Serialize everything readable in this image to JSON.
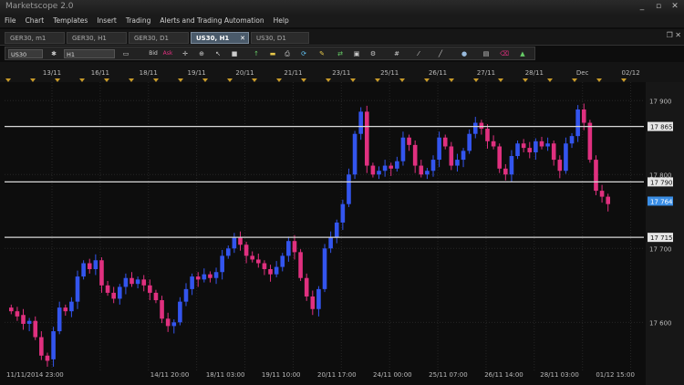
{
  "app": {
    "title": "Marketscope 2.0",
    "minimize": "_",
    "restore": "▫",
    "close": "✕"
  },
  "menu": [
    "File",
    "Chart",
    "Templates",
    "Insert",
    "Trading",
    "Alerts and Trading Automation",
    "Help"
  ],
  "tabs": [
    {
      "label": "GER30, m1",
      "active": false
    },
    {
      "label": "GER30, H1",
      "active": false
    },
    {
      "label": "GER30, D1",
      "active": false
    },
    {
      "label": "US30, H1",
      "active": true
    },
    {
      "label": "US30, D1",
      "active": false
    }
  ],
  "toolbar": {
    "instrument": "US30",
    "timeframe": "H1",
    "bid_label": "Bid",
    "ask_label": "Ask"
  },
  "colors": {
    "bull": "#3355ee",
    "bear": "#e0307f",
    "hline": "#d8d8d8",
    "price_tag": "#3a8ee6",
    "marker": "#c89b2a"
  },
  "chart_data": {
    "type": "candlestick",
    "y_ticks": [
      17600,
      17700,
      17800,
      17900
    ],
    "y_tick_labels": [
      "17 600",
      "17 700",
      "17 800",
      "17 900"
    ],
    "ylim": [
      17535,
      17925
    ],
    "top_date_labels": [
      "13/11",
      "16/11",
      "18/11",
      "19/11",
      "20/11",
      "21/11",
      "23/11",
      "25/11",
      "26/11",
      "27/11",
      "28/11",
      "Dec",
      "02/12"
    ],
    "bottom_time_labels": [
      "11/11/2014 23:00",
      "14/11 20:00",
      "18/11 03:00",
      "19/11 10:00",
      "20/11 17:00",
      "24/11 00:00",
      "25/11 07:00",
      "26/11 14:00",
      "28/11 03:00",
      "01/12 15:00"
    ],
    "horizontal_lines": [
      {
        "value": 17865,
        "label": "17 865"
      },
      {
        "value": 17790,
        "label": "17 790"
      },
      {
        "value": 17715,
        "label": "17 715"
      }
    ],
    "current_price": {
      "value": 17764,
      "label": "17 764"
    },
    "candles": [
      [
        17620,
        17615
      ],
      [
        17615,
        17608
      ],
      [
        17610,
        17598
      ],
      [
        17598,
        17602
      ],
      [
        17602,
        17580
      ],
      [
        17580,
        17555
      ],
      [
        17555,
        17548
      ],
      [
        17550,
        17588
      ],
      [
        17588,
        17620
      ],
      [
        17620,
        17615
      ],
      [
        17615,
        17628
      ],
      [
        17628,
        17662
      ],
      [
        17662,
        17680
      ],
      [
        17680,
        17672
      ],
      [
        17672,
        17684
      ],
      [
        17684,
        17650
      ],
      [
        17650,
        17640
      ],
      [
        17640,
        17632
      ],
      [
        17632,
        17648
      ],
      [
        17648,
        17660
      ],
      [
        17660,
        17652
      ],
      [
        17652,
        17658
      ],
      [
        17658,
        17650
      ],
      [
        17650,
        17640
      ],
      [
        17640,
        17630
      ],
      [
        17630,
        17605
      ],
      [
        17605,
        17595
      ],
      [
        17595,
        17600
      ],
      [
        17600,
        17628
      ],
      [
        17628,
        17645
      ],
      [
        17645,
        17662
      ],
      [
        17662,
        17658
      ],
      [
        17658,
        17665
      ],
      [
        17665,
        17660
      ],
      [
        17660,
        17668
      ],
      [
        17668,
        17690
      ],
      [
        17690,
        17700
      ],
      [
        17700,
        17715
      ],
      [
        17715,
        17705
      ],
      [
        17705,
        17690
      ],
      [
        17690,
        17685
      ],
      [
        17685,
        17680
      ],
      [
        17680,
        17672
      ],
      [
        17672,
        17665
      ],
      [
        17665,
        17675
      ],
      [
        17675,
        17690
      ],
      [
        17690,
        17710
      ],
      [
        17710,
        17695
      ],
      [
        17695,
        17660
      ],
      [
        17660,
        17635
      ],
      [
        17635,
        17618
      ],
      [
        17618,
        17645
      ],
      [
        17645,
        17700
      ],
      [
        17700,
        17715
      ],
      [
        17715,
        17735
      ],
      [
        17735,
        17760
      ],
      [
        17760,
        17800
      ],
      [
        17800,
        17855
      ],
      [
        17855,
        17885
      ],
      [
        17885,
        17812
      ],
      [
        17812,
        17800
      ],
      [
        17800,
        17805
      ],
      [
        17805,
        17812
      ],
      [
        17812,
        17808
      ],
      [
        17808,
        17818
      ],
      [
        17818,
        17850
      ],
      [
        17850,
        17840
      ],
      [
        17840,
        17812
      ],
      [
        17812,
        17800
      ],
      [
        17800,
        17805
      ],
      [
        17805,
        17820
      ],
      [
        17820,
        17850
      ],
      [
        17850,
        17838
      ],
      [
        17838,
        17812
      ],
      [
        17812,
        17820
      ],
      [
        17820,
        17832
      ],
      [
        17832,
        17855
      ],
      [
        17855,
        17870
      ],
      [
        17870,
        17862
      ],
      [
        17862,
        17845
      ],
      [
        17845,
        17838
      ],
      [
        17838,
        17808
      ],
      [
        17808,
        17800
      ],
      [
        17800,
        17825
      ],
      [
        17825,
        17842
      ],
      [
        17842,
        17836
      ],
      [
        17836,
        17830
      ],
      [
        17830,
        17845
      ],
      [
        17845,
        17838
      ],
      [
        17838,
        17842
      ],
      [
        17842,
        17820
      ],
      [
        17820,
        17805
      ],
      [
        17805,
        17842
      ],
      [
        17842,
        17852
      ],
      [
        17852,
        17888
      ],
      [
        17888,
        17870
      ],
      [
        17870,
        17820
      ],
      [
        17820,
        17778
      ],
      [
        17778,
        17770
      ],
      [
        17770,
        17760
      ]
    ]
  }
}
